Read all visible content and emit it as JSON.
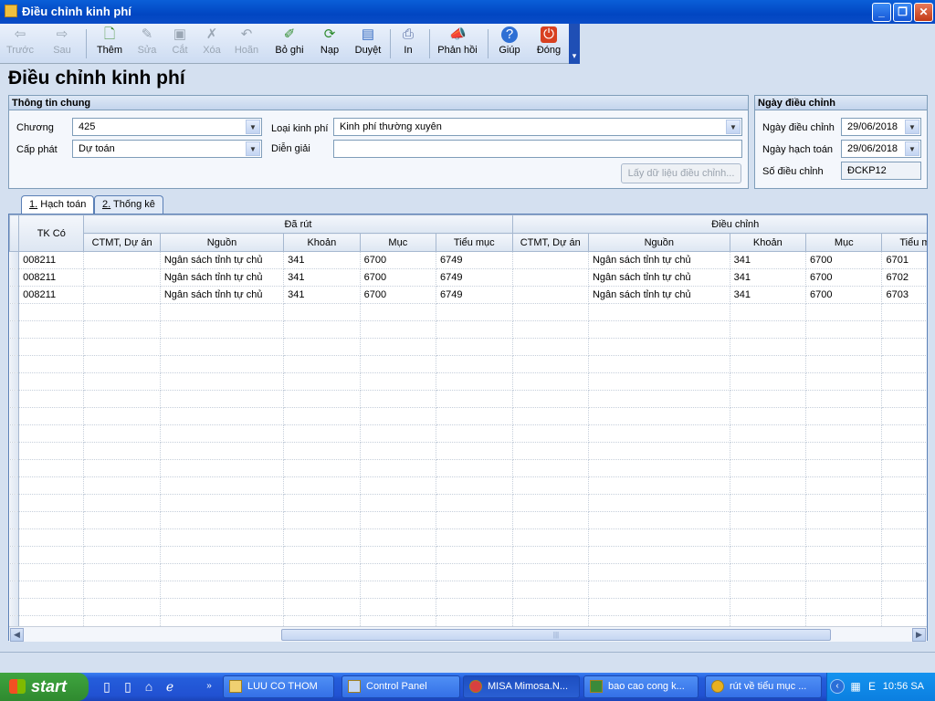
{
  "window": {
    "title": "Điều chỉnh kinh phí"
  },
  "toolbar": {
    "back": "Trước",
    "forward": "Sau",
    "add": "Thêm",
    "edit": "Sửa",
    "cut": "Cắt",
    "delete": "Xóa",
    "undo": "Hoãn",
    "unpost": "Bỏ ghi",
    "load": "Nạp",
    "approve": "Duyệt",
    "print": "In",
    "feedback": "Phản hồi",
    "help": "Giúp",
    "close": "Đóng"
  },
  "page_title": "Điều chỉnh kinh phí",
  "general": {
    "header": "Thông tin chung",
    "chuong_label": "Chương",
    "chuong_value": "425",
    "cap_phat_label": "Cấp phát",
    "cap_phat_value": "Dự toán",
    "loai_kinh_phi_label": "Loại kinh phí",
    "loai_kinh_phi_value": "Kinh phí thường xuyên",
    "dien_giai_label": "Diễn giải",
    "dien_giai_value": "",
    "fetch_button": "Lấy dữ liệu điều chỉnh..."
  },
  "dates": {
    "header": "Ngày điều chỉnh",
    "ngay_dieu_chinh_label": "Ngày điều chỉnh",
    "ngay_dieu_chinh_value": "29/06/2018",
    "ngay_hach_toan_label": "Ngày hạch toán",
    "ngay_hach_toan_value": "29/06/2018",
    "so_dieu_chinh_label": "Số điều chỉnh",
    "so_dieu_chinh_value": "ĐCKP12"
  },
  "tabs": [
    {
      "num": "1.",
      "label": " Hạch toán"
    },
    {
      "num": "2.",
      "label": " Thống kê"
    }
  ],
  "grid": {
    "group_da_rut": "Đã rút",
    "group_dieu_chinh": "Điều chỉnh",
    "col_tk_co": "TK Có",
    "columns": [
      "CTMT, Dự án",
      "Nguồn",
      "Khoản",
      "Mục",
      "Tiểu mục",
      "CTMT, Dự án",
      "Nguồn",
      "Khoản",
      "Mục",
      "Tiểu mục"
    ],
    "rows": [
      [
        "008211",
        "",
        "Ngân sách tỉnh  tự chủ",
        "341",
        "6700",
        "6749",
        "",
        "Ngân sách tỉnh  tự chủ",
        "341",
        "6700",
        "6701"
      ],
      [
        "008211",
        "",
        "Ngân sách tỉnh  tự chủ",
        "341",
        "6700",
        "6749",
        "",
        "Ngân sách tỉnh  tự chủ",
        "341",
        "6700",
        "6702"
      ],
      [
        "008211",
        "",
        "Ngân sách tỉnh  tự chủ",
        "341",
        "6700",
        "6749",
        "",
        "Ngân sách tỉnh  tự chủ",
        "341",
        "6700",
        "6703"
      ]
    ]
  },
  "taskbar": {
    "start": "start",
    "tasks": [
      "LUU CO THOM",
      "Control Panel",
      "MISA Mimosa.N...",
      "bao cao cong k...",
      "rút về tiểu mục ..."
    ],
    "clock": "10:56 SA"
  }
}
